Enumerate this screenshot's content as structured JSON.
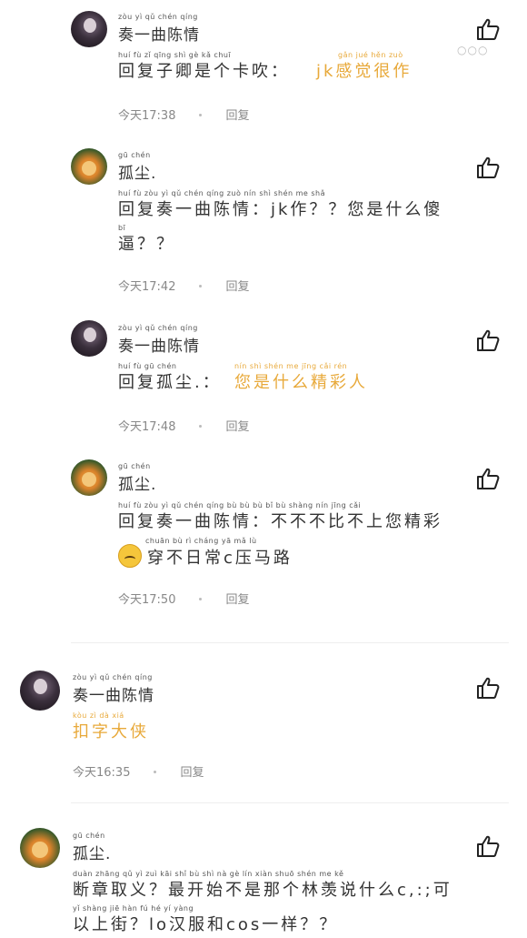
{
  "thumb_icon": "thumbs-up-outline-icon",
  "comments": [
    {
      "author_pinyin": "zòu  yì  qǔ chén qíng",
      "author": "奏一曲陈情",
      "body_pinyin": "huí  fù   zǐ  qīng  shì  gè   kǎ  chuī",
      "body": "回复子卿是个卡吹：",
      "highlight_pinyin": "gǎn  jué  hěn  zuò",
      "highlight": "jk感觉很作",
      "time": "今天17:38",
      "reply": "回复",
      "more": "○○○"
    },
    {
      "author_pinyin": "gū chén",
      "author": "孤尘.",
      "body_pinyin": "huí  fù  zòu  yì   qǔ  chén qíng                 zuò                 nín  shì  shén  me  shǎ",
      "body": "回复奏一曲陈情：jk作？？您是什么傻",
      "body2_pinyin": "bī",
      "body2": "逼？？",
      "time": "今天17:42",
      "reply": "回复"
    },
    {
      "author_pinyin": "zòu  yì  qǔ chén qíng",
      "author": "奏一曲陈情",
      "body_pinyin": "huí  fù   gū  chén",
      "body": "回复孤尘.：",
      "highlight_pinyin": "nín  shì shén  me  jīng  cǎi  rén",
      "highlight": "您是什么精彩人",
      "time": "今天17:48",
      "reply": "回复"
    },
    {
      "author_pinyin": "gū chén",
      "author": "孤尘.",
      "body_pinyin": "huí  fù  zòu  yì   qǔ  chén qíng         bù   bù   bù    bǐ    bù shàng nín  jīng  cǎi",
      "body": "回复奏一曲陈情：不不不比不上您精彩",
      "body2_pinyin": "chuān  bù    rì  cháng     yā   mǎ   lù",
      "body2": "穿不日常c压马路",
      "time": "今天17:50",
      "reply": "回复"
    },
    {
      "author_pinyin": "zòu  yì  qǔ chén qíng",
      "author": "奏一曲陈情",
      "highlight_pinyin": "kòu  zì   dà   xiá",
      "highlight": "扣字大侠",
      "time": "今天16:35",
      "reply": "回复"
    },
    {
      "author_pinyin": "gū chén",
      "author": "孤尘.",
      "body_pinyin": "duàn zhāng qǔ   yì        zuì  kāi  shǐ   bù  shì  nà   gè   lín  xiàn  shuō shén  me       kě",
      "body": "断章取义？最开始不是那个林羡说什么c,:;可",
      "body2_pinyin": "yǐ  shàng  jiē          hàn   fú   hé         yí  yàng",
      "body2": "以上街？lo汉服和cos一样？？"
    }
  ]
}
